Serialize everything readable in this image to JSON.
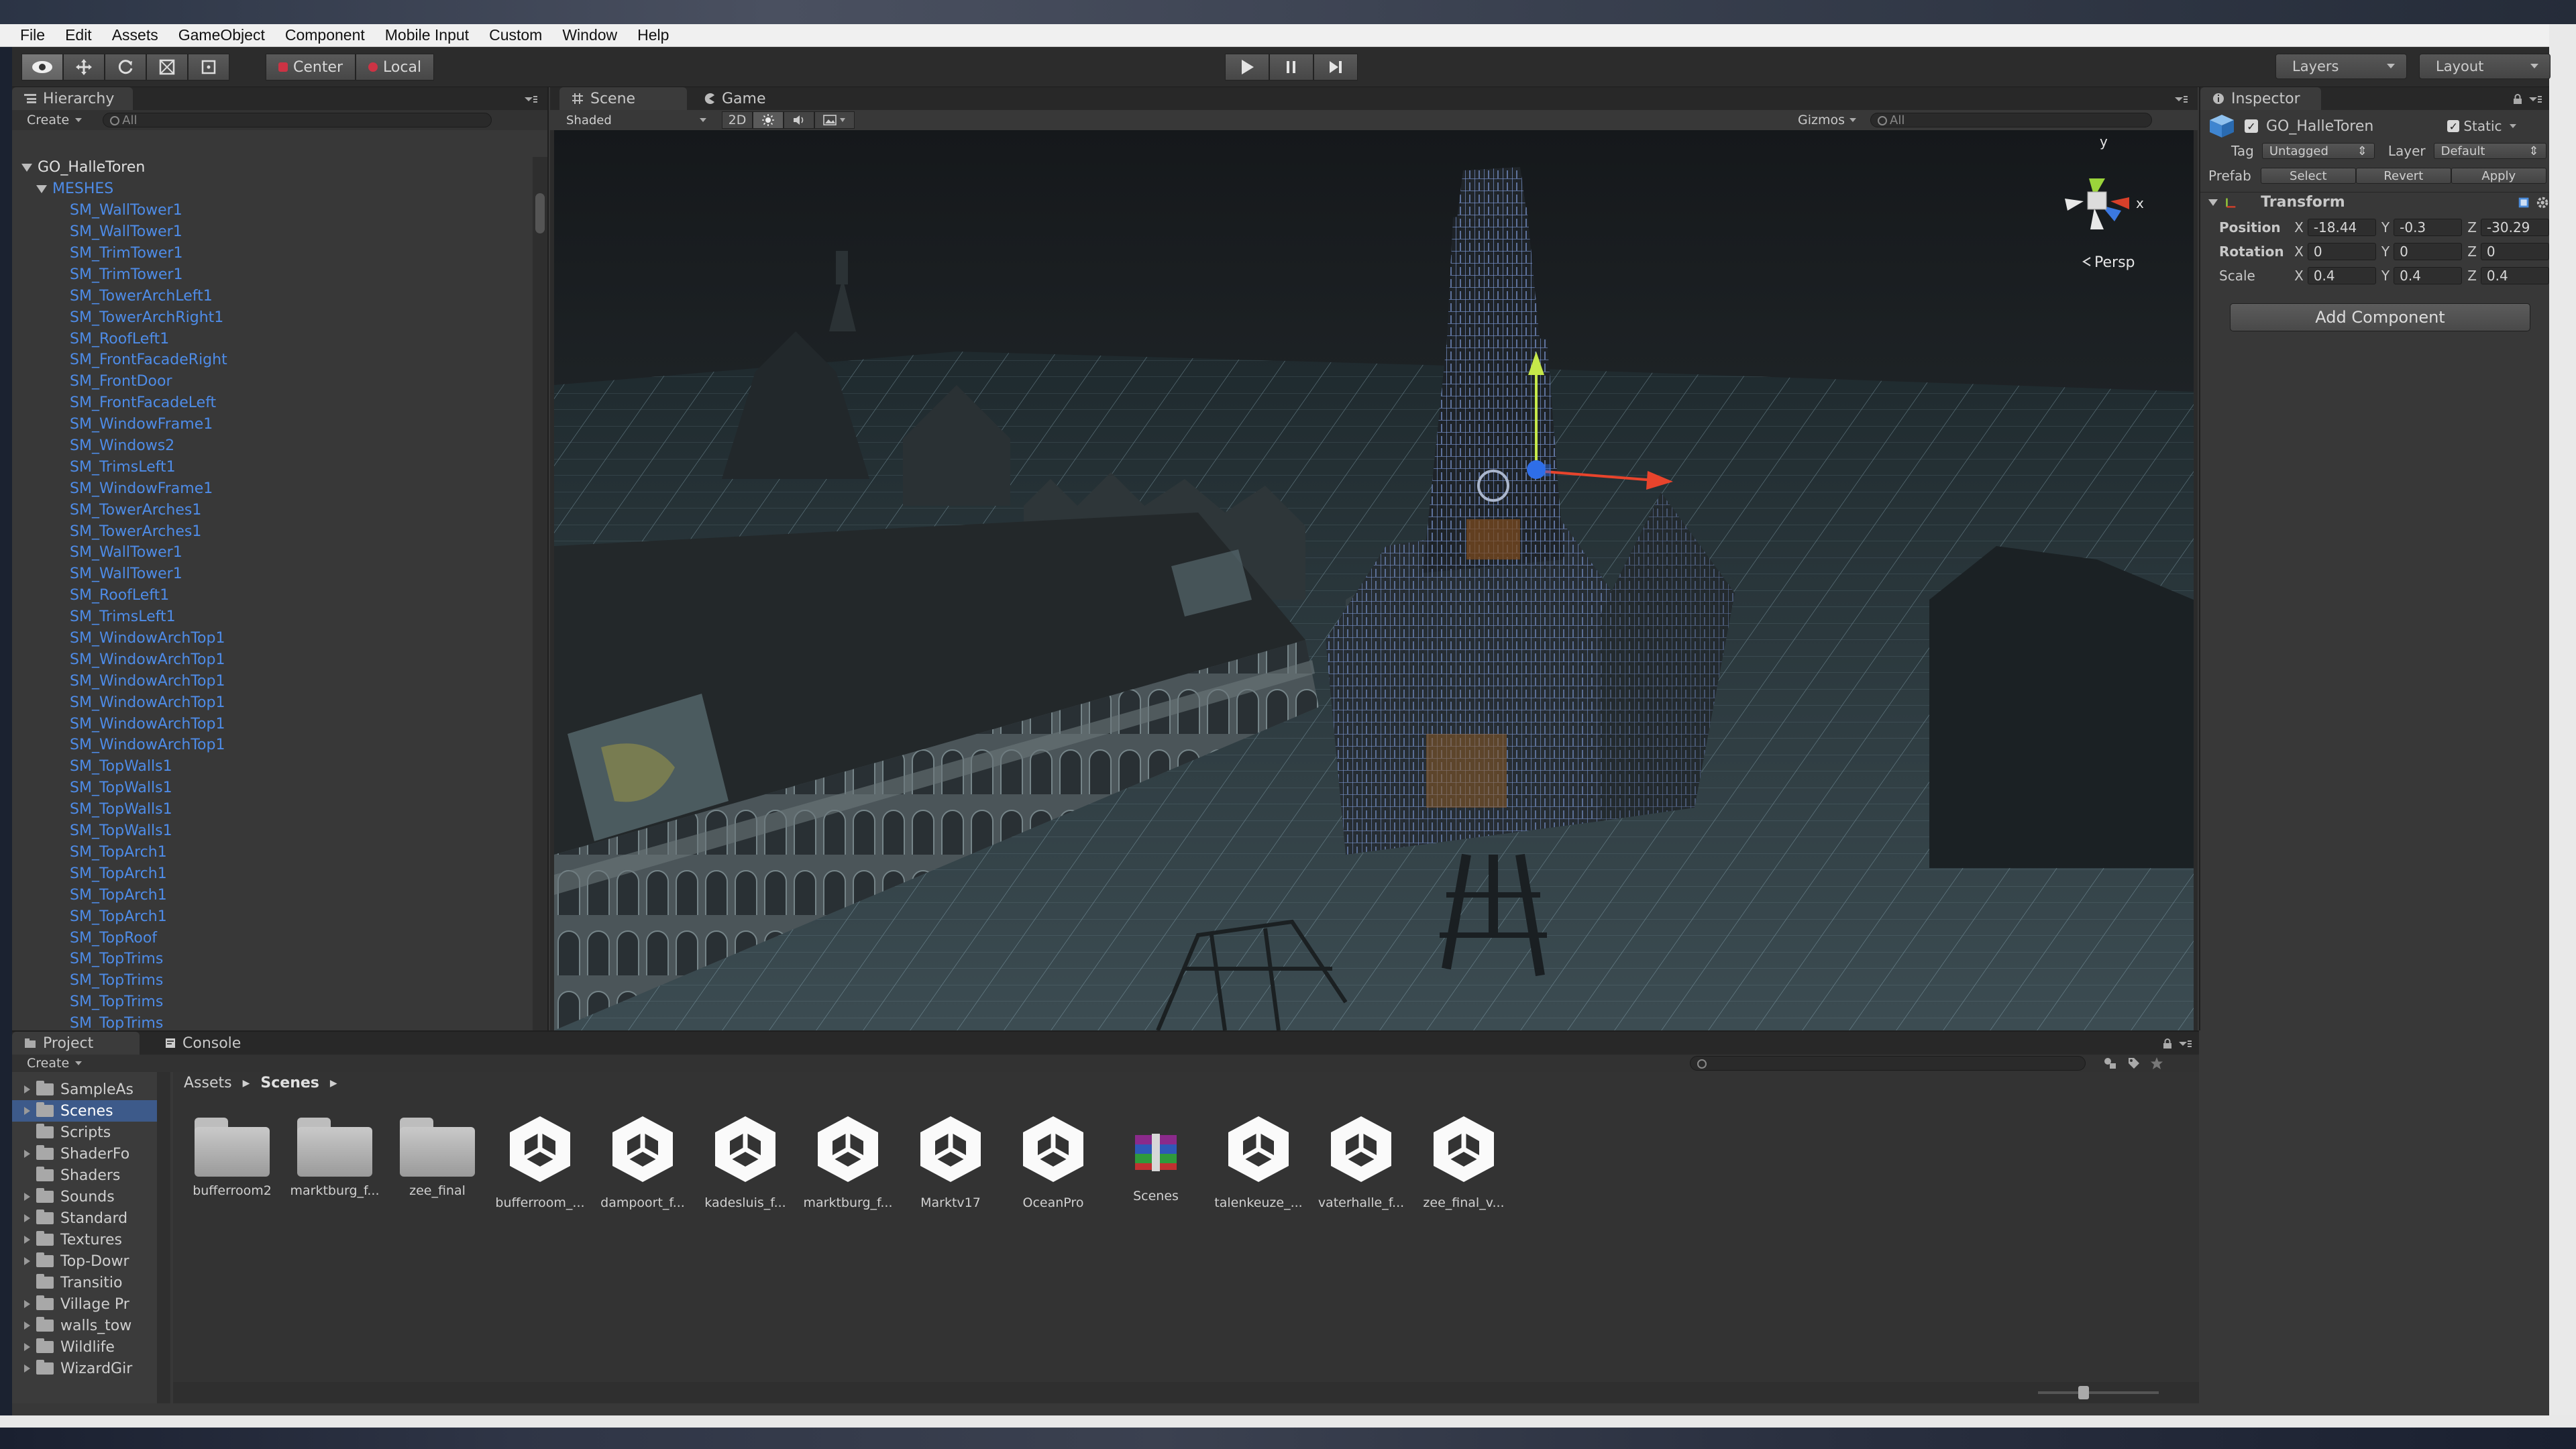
{
  "menu": [
    "File",
    "Edit",
    "Assets",
    "GameObject",
    "Component",
    "Mobile Input",
    "Custom",
    "Window",
    "Help"
  ],
  "toolbar": {
    "pivot_label": "Center",
    "space_label": "Local",
    "layers_label": "Layers",
    "layout_label": "Layout"
  },
  "hierarchy": {
    "tab": "Hierarchy",
    "create": "Create",
    "search_placeholder": "All",
    "root": "GO_HalleToren",
    "group": "MESHES",
    "items": [
      "SM_WallTower1",
      "SM_WallTower1",
      "SM_TrimTower1",
      "SM_TrimTower1",
      "SM_TowerArchLeft1",
      "SM_TowerArchRight1",
      "SM_RoofLeft1",
      "SM_FrontFacadeRight",
      "SM_FrontDoor",
      "SM_FrontFacadeLeft",
      "SM_WindowFrame1",
      "SM_Windows2",
      "SM_TrimsLeft1",
      "SM_WindowFrame1",
      "SM_TowerArches1",
      "SM_TowerArches1",
      "SM_WallTower1",
      "SM_WallTower1",
      "SM_RoofLeft1",
      "SM_TrimsLeft1",
      "SM_WindowArchTop1",
      "SM_WindowArchTop1",
      "SM_WindowArchTop1",
      "SM_WindowArchTop1",
      "SM_WindowArchTop1",
      "SM_WindowArchTop1",
      "SM_TopWalls1",
      "SM_TopWalls1",
      "SM_TopWalls1",
      "SM_TopWalls1",
      "SM_TopArch1",
      "SM_TopArch1",
      "SM_TopArch1",
      "SM_TopArch1",
      "SM_TopRoof",
      "SM_TopTrims",
      "SM_TopTrims",
      "SM_TopTrims",
      "SM_TopTrims"
    ]
  },
  "scene": {
    "tab_scene": "Scene",
    "tab_game": "Game",
    "shading": "Shaded",
    "mode_2d": "2D",
    "gizmos": "Gizmos",
    "search_placeholder": "All",
    "persp": "Persp",
    "axis_y": "y",
    "axis_x": "x"
  },
  "inspector": {
    "tab": "Inspector",
    "object_name": "GO_HalleToren",
    "static_label": "Static",
    "tag_label": "Tag",
    "tag_value": "Untagged",
    "layer_label": "Layer",
    "layer_value": "Default",
    "prefab_label": "Prefab",
    "prefab_select": "Select",
    "prefab_revert": "Revert",
    "prefab_apply": "Apply",
    "component": "Transform",
    "position_label": "Position",
    "rotation_label": "Rotation",
    "scale_label": "Scale",
    "position": {
      "x": "-18.44",
      "y": "-0.3",
      "z": "-30.29"
    },
    "rotation": {
      "x": "0",
      "y": "0",
      "z": "0"
    },
    "scale": {
      "x": "0.4",
      "y": "0.4",
      "z": "0.4"
    },
    "axis_x": "X",
    "axis_y": "Y",
    "axis_z": "Z",
    "add_component": "Add Component"
  },
  "project": {
    "tab_project": "Project",
    "tab_console": "Console",
    "create": "Create",
    "breadcrumb": [
      "Assets",
      "Scenes"
    ],
    "tree": [
      "SampleAs",
      "Scenes",
      "Scripts",
      "ShaderFo",
      "Shaders",
      "Sounds",
      "Standard",
      "Textures",
      "Top-Dowr",
      "Transitio",
      "Village Pr",
      "walls_tow",
      "Wildlife",
      "WizardGir"
    ],
    "assets": [
      {
        "name": "bufferroom2",
        "kind": "folder"
      },
      {
        "name": "marktburg_f...",
        "kind": "folder"
      },
      {
        "name": "zee_final",
        "kind": "folder"
      },
      {
        "name": "bufferroom_...",
        "kind": "scene"
      },
      {
        "name": "dampoort_f...",
        "kind": "scene"
      },
      {
        "name": "kadesluis_f...",
        "kind": "scene"
      },
      {
        "name": "marktburg_f...",
        "kind": "scene"
      },
      {
        "name": "Marktv17",
        "kind": "scene"
      },
      {
        "name": "OceanPro",
        "kind": "scene"
      },
      {
        "name": "Scenes",
        "kind": "archive"
      },
      {
        "name": "talenkeuze_...",
        "kind": "scene"
      },
      {
        "name": "vaterhalle_f...",
        "kind": "scene"
      },
      {
        "name": "zee_final_v...",
        "kind": "scene"
      }
    ]
  },
  "colors": {
    "selection_blue": "#3d5a8a",
    "hierarchy_link": "#4e8ce8",
    "background": "#383838"
  }
}
